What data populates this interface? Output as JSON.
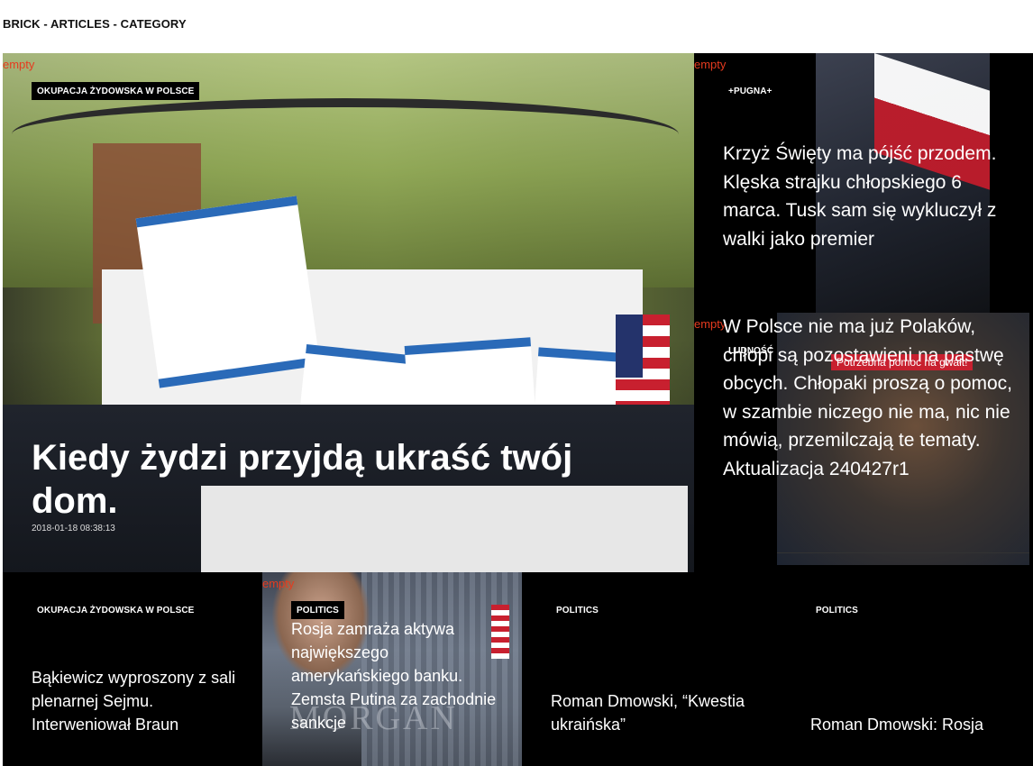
{
  "breadcrumb": "BRICK - ARTICLES - CATEGORY",
  "empty_label": "empty",
  "cards": [
    {
      "category": "OKUPACJA ŻYDOWSKA W POLSCE",
      "title": "Kiedy żydzi przyjdą ukraść twój dom.",
      "date": "2018-01-18 08:38:13"
    },
    {
      "category": "+PUGNA+",
      "title": "Krzyż Święty ma pójść przodem. Klęska strajku chłopskiego 6 marca. Tusk sam się wykluczył z walki jako premier"
    },
    {
      "category": "LUDNOŚĆ",
      "image_tag": "Potrzebna pomoc na gwałt!",
      "title": "W Polsce nie ma już Polaków, chłopi są pozostawieni na pastwę obcych. Chłopaki proszą o pomoc, w szambie niczego nie ma, nic nie mówią, przemilczają te tematy. Aktualizacja 240427r1"
    },
    {
      "category": "OKUPACJA ŻYDOWSKA W POLSCE",
      "title": "Bąkiewicz wyproszony z sali plenarnej Sejmu. Interweniował Braun"
    },
    {
      "category": "POLITICS",
      "title": "Rosja zamraża aktywa największego amerykańskiego banku. Zemsta Putina za zachodnie sankcje",
      "image_text": "MORGAN"
    },
    {
      "category": "POLITICS",
      "title": "Roman Dmowski, “Kwestia ukraińska”"
    },
    {
      "category": "POLITICS",
      "title": "Roman Dmowski: Rosja"
    }
  ],
  "colors": {
    "empty": "#e63b1f",
    "badge_bg": "#000000",
    "card_bg": "#000000",
    "tag_red": "#c8202f"
  }
}
